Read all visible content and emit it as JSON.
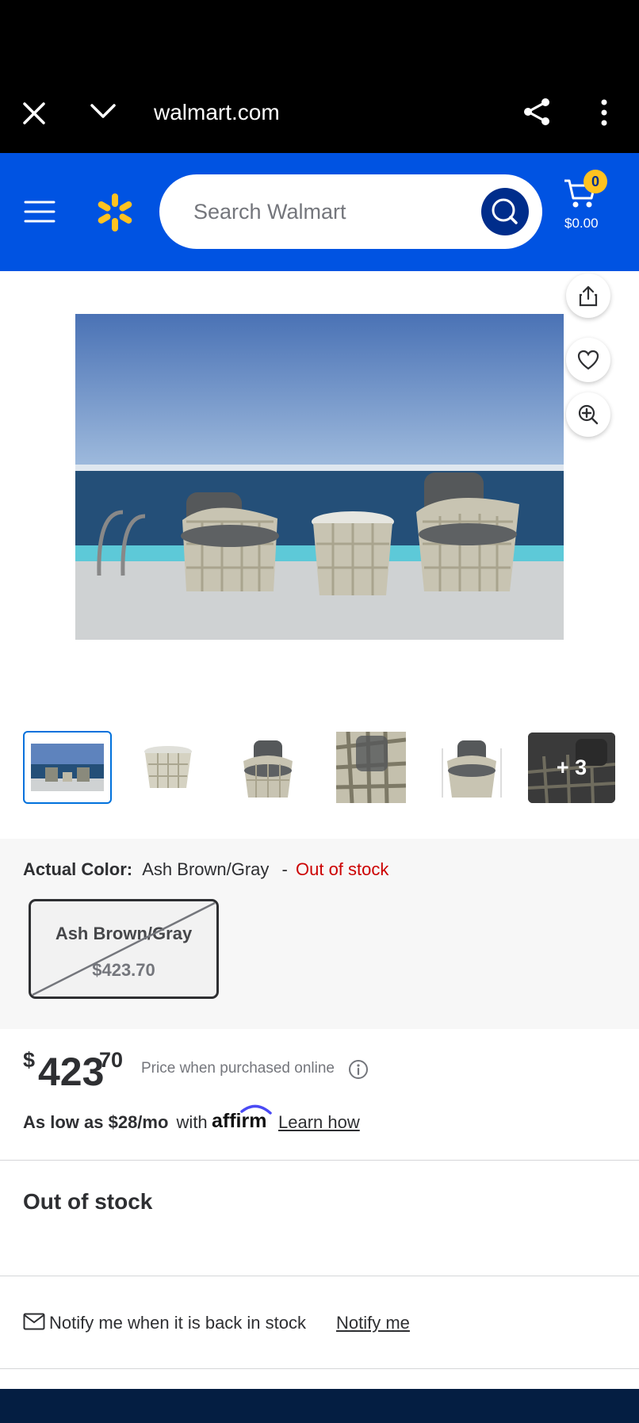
{
  "browser": {
    "url": "walmart.com"
  },
  "header": {
    "search_placeholder": "Search Walmart",
    "cart_count": "0",
    "cart_total": "$0.00"
  },
  "gallery": {
    "more_label": "+ 3"
  },
  "variant": {
    "label": "Actual Color:",
    "value": "Ash Brown/Gray",
    "separator": "-",
    "status": "Out of stock",
    "option_name": "Ash Brown/Gray",
    "option_price": "$423.70"
  },
  "price": {
    "currency": "$",
    "dollars": "423",
    "cents": "70",
    "note": "Price when purchased online"
  },
  "financing": {
    "text_bold": "As low as $28/mo",
    "text_with": "with",
    "provider": "affirm",
    "link": "Learn how"
  },
  "availability": {
    "title": "Out of stock"
  },
  "notify": {
    "text": "Notify me when it is back in stock",
    "link": "Notify me"
  },
  "colors": {
    "walmart_blue": "#0053e2",
    "spark_yellow": "#ffc220",
    "out_of_stock_red": "#cc0000"
  }
}
